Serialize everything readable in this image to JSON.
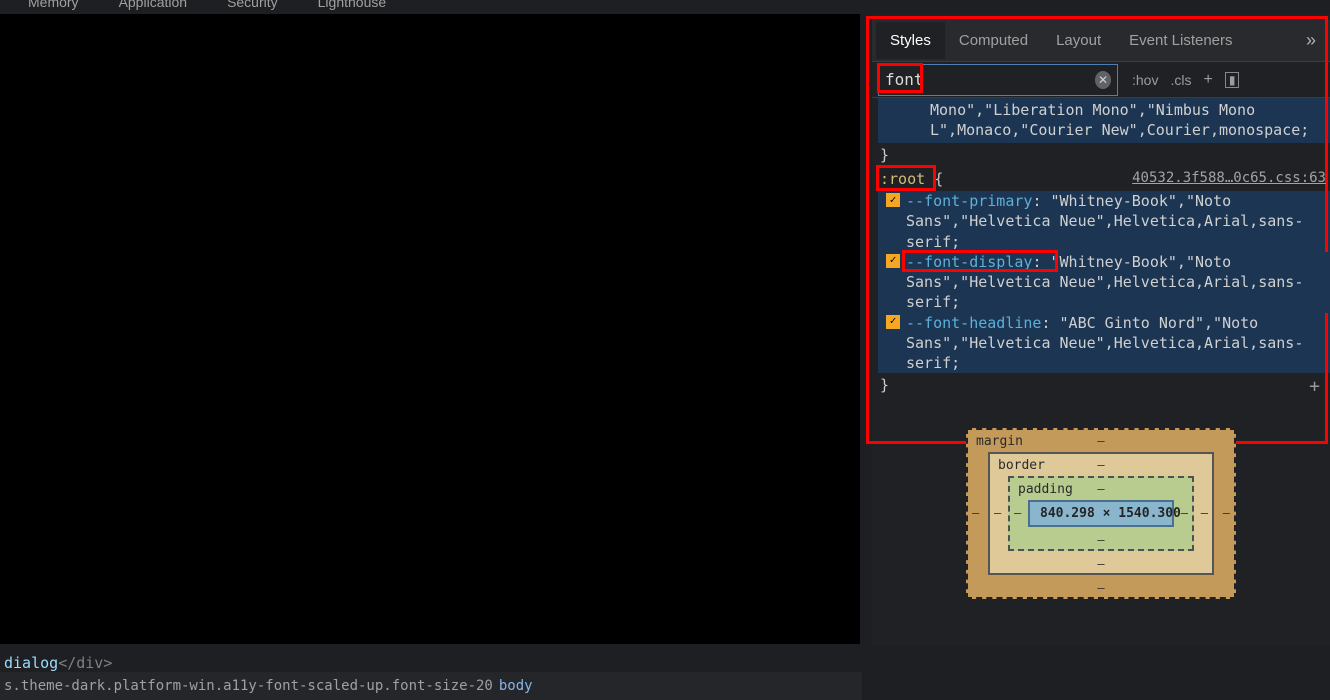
{
  "top_tabs": {
    "memory": "Memory",
    "application": "Application",
    "security": "Security",
    "lighthouse": "Lighthouse"
  },
  "panel_tabs": {
    "styles": "Styles",
    "computed": "Computed",
    "layout": "Layout",
    "event_listeners": "Event Listeners"
  },
  "filter": {
    "value": "font",
    "hov": ":hov",
    "cls": ".cls"
  },
  "rule0_tail": "Mono\",\"Liberation Mono\",\"Nimbus Mono L\",Monaco,\"Courier New\",Courier,monospace;",
  "rule1": {
    "selector": ":root",
    "source": "40532.3f588…0c65.css:63",
    "p1_name": "--font-primary",
    "p1_val": "\"Whitney-Book\",\"Noto Sans\",\"Helvetica Neue\",Helvetica,Arial,sans-serif;",
    "p2_name": "--font-display",
    "p2_val": "\"Whitney-Book\",\"Noto Sans\",\"Helvetica Neue\",Helvetica,Arial,sans-serif;",
    "p3_name": "--font-headline",
    "p3_val": "\"ABC Ginto Nord\",\"Noto Sans\",\"Helvetica Neue\",Helvetica,Arial,sans-serif;"
  },
  "box_model": {
    "margin": "margin",
    "border": "border",
    "padding": "padding",
    "content": "840.298 × 1540.300",
    "dash": "–"
  },
  "dom": {
    "text": "dialog",
    "close": "</div>"
  },
  "breadcrumb": {
    "classes": "s.theme-dark.platform-win.a11y-font-scaled-up.font-size-20",
    "body": "body"
  }
}
